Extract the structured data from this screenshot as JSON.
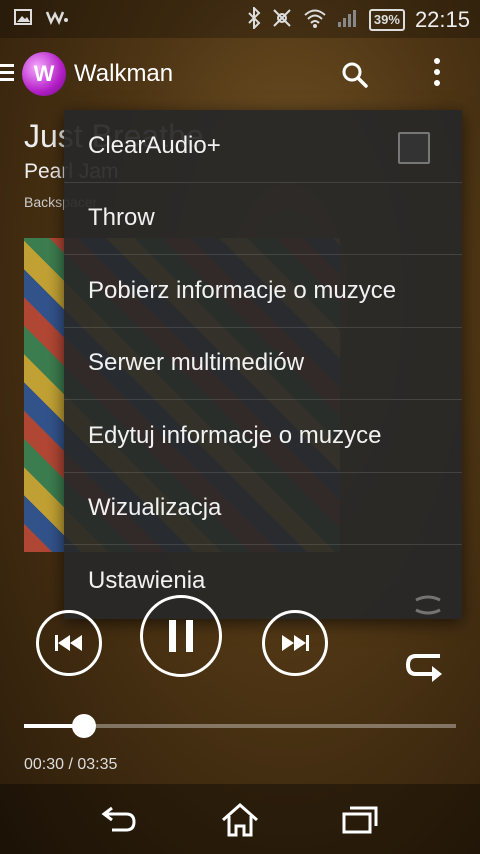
{
  "status": {
    "battery": "39%",
    "time": "22:15"
  },
  "app": {
    "title": "Walkman"
  },
  "track": {
    "title": "Just Breathe",
    "artist": "Pearl Jam",
    "album": "Backspacer"
  },
  "menu": {
    "items": [
      {
        "label": "ClearAudio+"
      },
      {
        "label": "Throw"
      },
      {
        "label": "Pobierz informacje o muzyce"
      },
      {
        "label": "Serwer multimediów"
      },
      {
        "label": "Edytuj informacje o muzyce"
      },
      {
        "label": "Wizualizacja"
      },
      {
        "label": "Ustawienia"
      }
    ]
  },
  "player": {
    "elapsed_total": "00:30 / 03:35",
    "progress": 0.14
  }
}
